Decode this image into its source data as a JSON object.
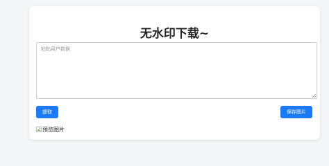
{
  "page": {
    "title": "无水印下载~"
  },
  "input": {
    "value": "",
    "placeholder": "粘贴用户数据"
  },
  "buttons": {
    "extract_label": "提取",
    "save_label": "保存图片"
  },
  "preview": {
    "alt_text": "预览图片",
    "icon": "broken-image-icon"
  },
  "colors": {
    "primary": "#1a7af8",
    "background": "#f4f5f7",
    "card": "#ffffff"
  }
}
